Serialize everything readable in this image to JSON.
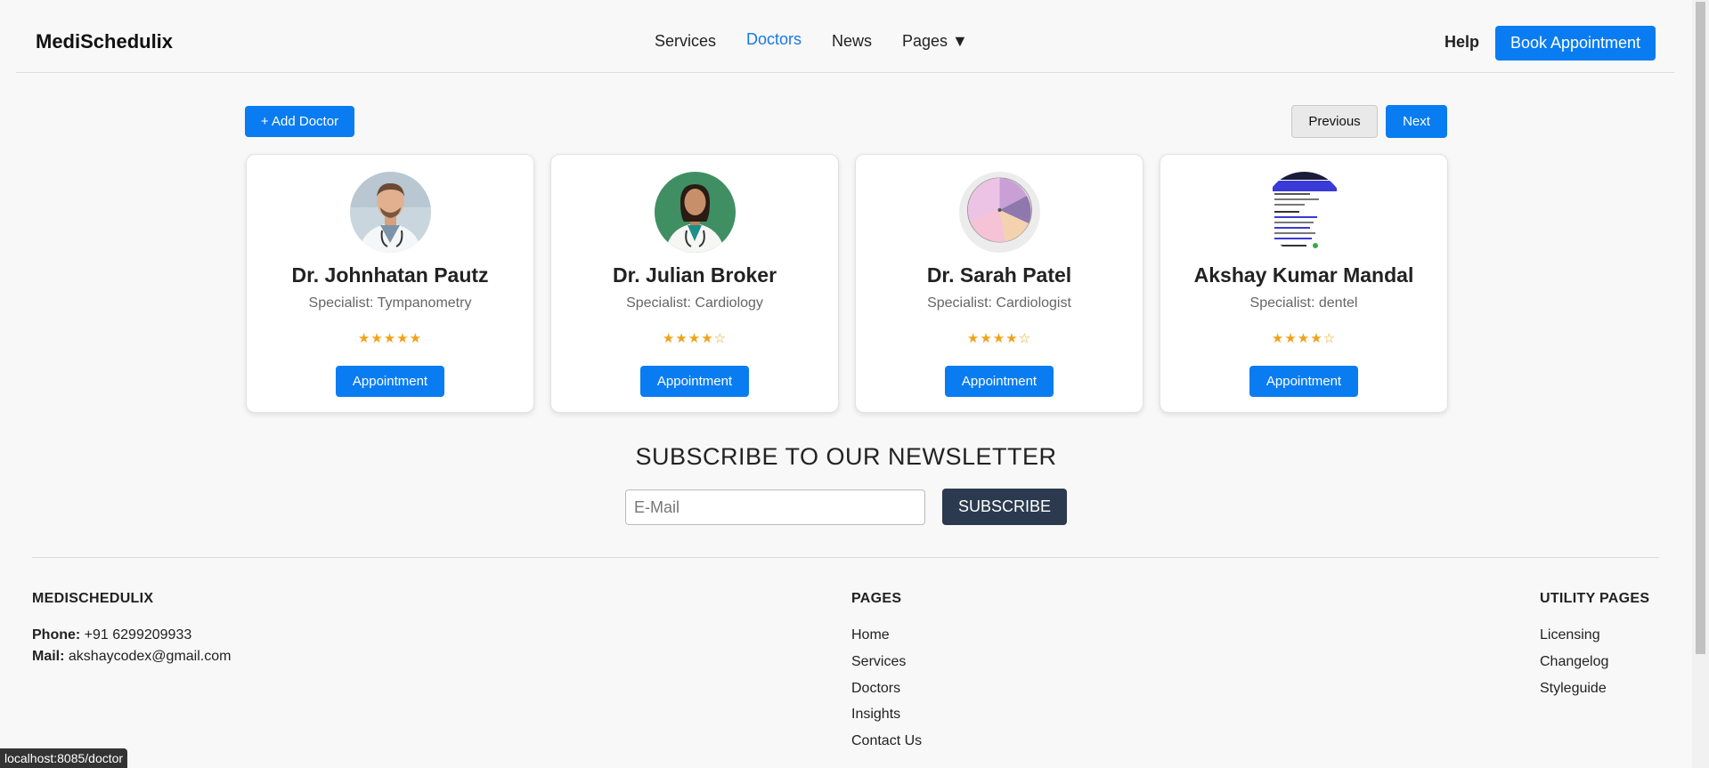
{
  "header": {
    "brand": "MediSchedulix",
    "nav": [
      {
        "label": "Services",
        "active": false
      },
      {
        "label": "Doctors",
        "active": true
      },
      {
        "label": "News",
        "active": false
      },
      {
        "label": "Pages ▼",
        "active": false
      }
    ],
    "help": "Help",
    "book_button": "Book Appointment"
  },
  "toolbar": {
    "add_doctor": "+ Add Doctor",
    "previous": "Previous",
    "next": "Next"
  },
  "doctors": [
    {
      "name": "Dr. Johnhatan Pautz",
      "specialty": "Specialist: Tympanometry",
      "stars": "★★★★★",
      "rating": 5,
      "button": "Appointment"
    },
    {
      "name": "Dr. Julian Broker",
      "specialty": "Specialist: Cardiology",
      "stars": "★★★★☆",
      "rating": 4,
      "button": "Appointment"
    },
    {
      "name": "Dr. Sarah Patel",
      "specialty": "Specialist: Cardiologist",
      "stars": "★★★★☆",
      "rating": 4,
      "button": "Appointment"
    },
    {
      "name": "Akshay Kumar Mandal",
      "specialty": "Specialist: dentel",
      "stars": "★★★★☆",
      "rating": 4,
      "button": "Appointment"
    }
  ],
  "newsletter": {
    "title": "SUBSCRIBE TO OUR NEWSLETTER",
    "placeholder": "E-Mail",
    "button": "SUBSCRIBE"
  },
  "footer": {
    "brand_heading": "MEDISCHEDULIX",
    "phone_label": "Phone:",
    "phone": "+91 6299209933",
    "mail_label": "Mail:",
    "mail": "akshaycodex@gmail.com",
    "pages_heading": "PAGES",
    "pages": [
      "Home",
      "Services",
      "Doctors",
      "Insights",
      "Contact Us"
    ],
    "utility_heading": "UTILITY PAGES",
    "utility": [
      "Licensing",
      "Changelog",
      "Styleguide"
    ]
  },
  "status_url": "localhost:8085/doctor",
  "colors": {
    "accent": "#0a7cf2",
    "subscribe_button": "#2b3a4e",
    "star": "#f0a21a"
  }
}
